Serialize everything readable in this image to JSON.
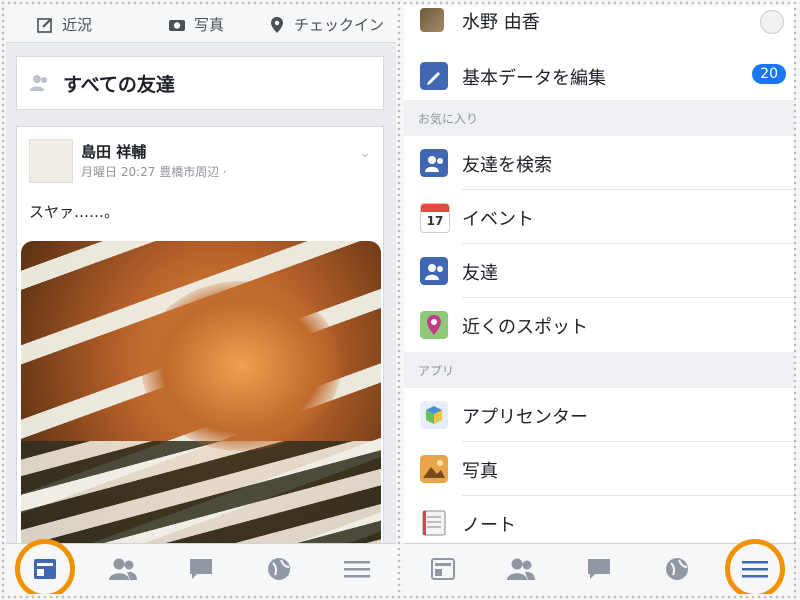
{
  "left": {
    "composer": {
      "status_label": "近況",
      "photo_label": "写真",
      "checkin_label": "チェックイン"
    },
    "friends_title": "すべての友達",
    "post": {
      "author": "島田 祥輔",
      "meta": "月曜日 20:27 豊橋市周辺 ·",
      "text": "スヤァ……。"
    },
    "tabbar": {
      "items": [
        "news-feed",
        "friends",
        "messages",
        "notifications",
        "more"
      ],
      "highlighted": "news-feed"
    }
  },
  "right": {
    "profile_name": "水野 由香",
    "edit_profile": "基本データを編集",
    "edit_badge": "20",
    "sections": {
      "favorites": "お気に入り",
      "apps": "アプリ"
    },
    "favorites": [
      "友達を検索",
      "イベント",
      "友達",
      "近くのスポット"
    ],
    "apps": [
      "アプリセンター",
      "写真",
      "ノート"
    ],
    "calendar_day": "17",
    "tabbar": {
      "highlighted": "more"
    }
  },
  "colors": {
    "highlight": "#f39200",
    "accent": "#1877f2",
    "fb_blue": "#4267b2"
  }
}
